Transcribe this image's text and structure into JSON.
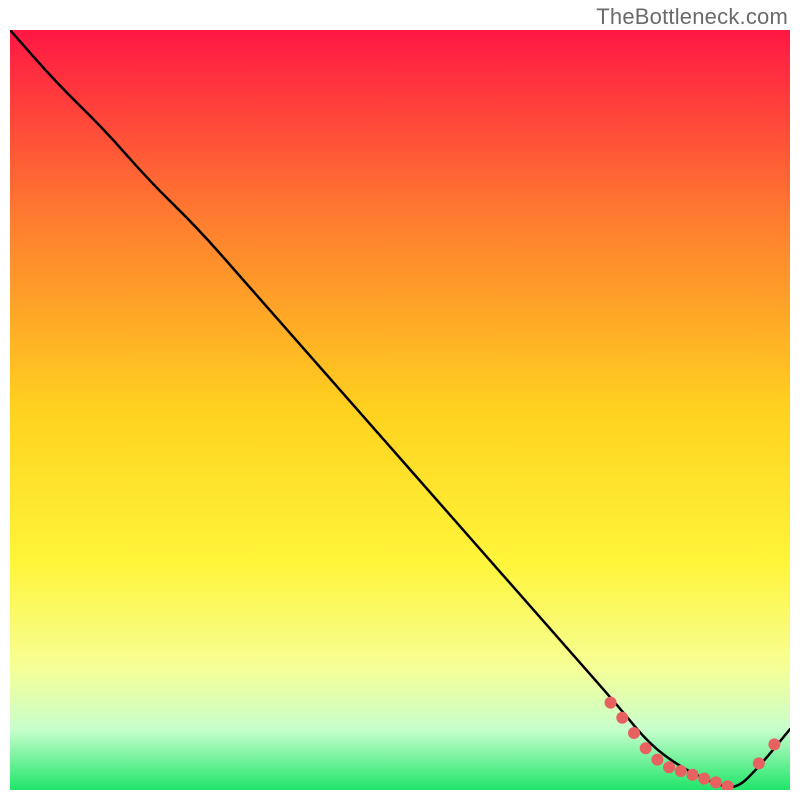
{
  "watermark": "TheBottleneck.com",
  "chart_data": {
    "type": "line",
    "title": "",
    "xlabel": "",
    "ylabel": "",
    "xlim": [
      0,
      100
    ],
    "ylim": [
      0,
      100
    ],
    "grid": false,
    "legend": false,
    "background_gradient": {
      "stops": [
        {
          "offset": 0.0,
          "color": "#ff1744"
        },
        {
          "offset": 0.25,
          "color": "#ff7d2f"
        },
        {
          "offset": 0.5,
          "color": "#ffd21f"
        },
        {
          "offset": 0.7,
          "color": "#fff53a"
        },
        {
          "offset": 0.84,
          "color": "#f6ff97"
        },
        {
          "offset": 0.92,
          "color": "#c8ffcc"
        },
        {
          "offset": 1.0,
          "color": "#1fe56a"
        }
      ]
    },
    "series": [
      {
        "name": "bottleneck-curve",
        "color": "#000000",
        "x": [
          0,
          6,
          12,
          18,
          24,
          30,
          36,
          42,
          48,
          54,
          60,
          66,
          72,
          78,
          82,
          86,
          90,
          93,
          96,
          100
        ],
        "y": [
          100,
          93,
          87,
          80,
          74,
          67,
          60,
          53,
          46,
          39,
          32,
          25,
          18,
          11,
          6,
          3,
          1,
          0,
          3,
          8
        ]
      }
    ],
    "markers": {
      "name": "highlight-points",
      "color": "#e86161",
      "x": [
        77,
        78.5,
        80,
        81.5,
        83,
        84.5,
        86,
        87.5,
        89,
        90.5,
        92,
        96,
        98
      ],
      "y": [
        11.5,
        9.5,
        7.5,
        5.5,
        4.0,
        3.0,
        2.5,
        2.0,
        1.5,
        1.0,
        0.5,
        3.5,
        6.0
      ]
    }
  }
}
